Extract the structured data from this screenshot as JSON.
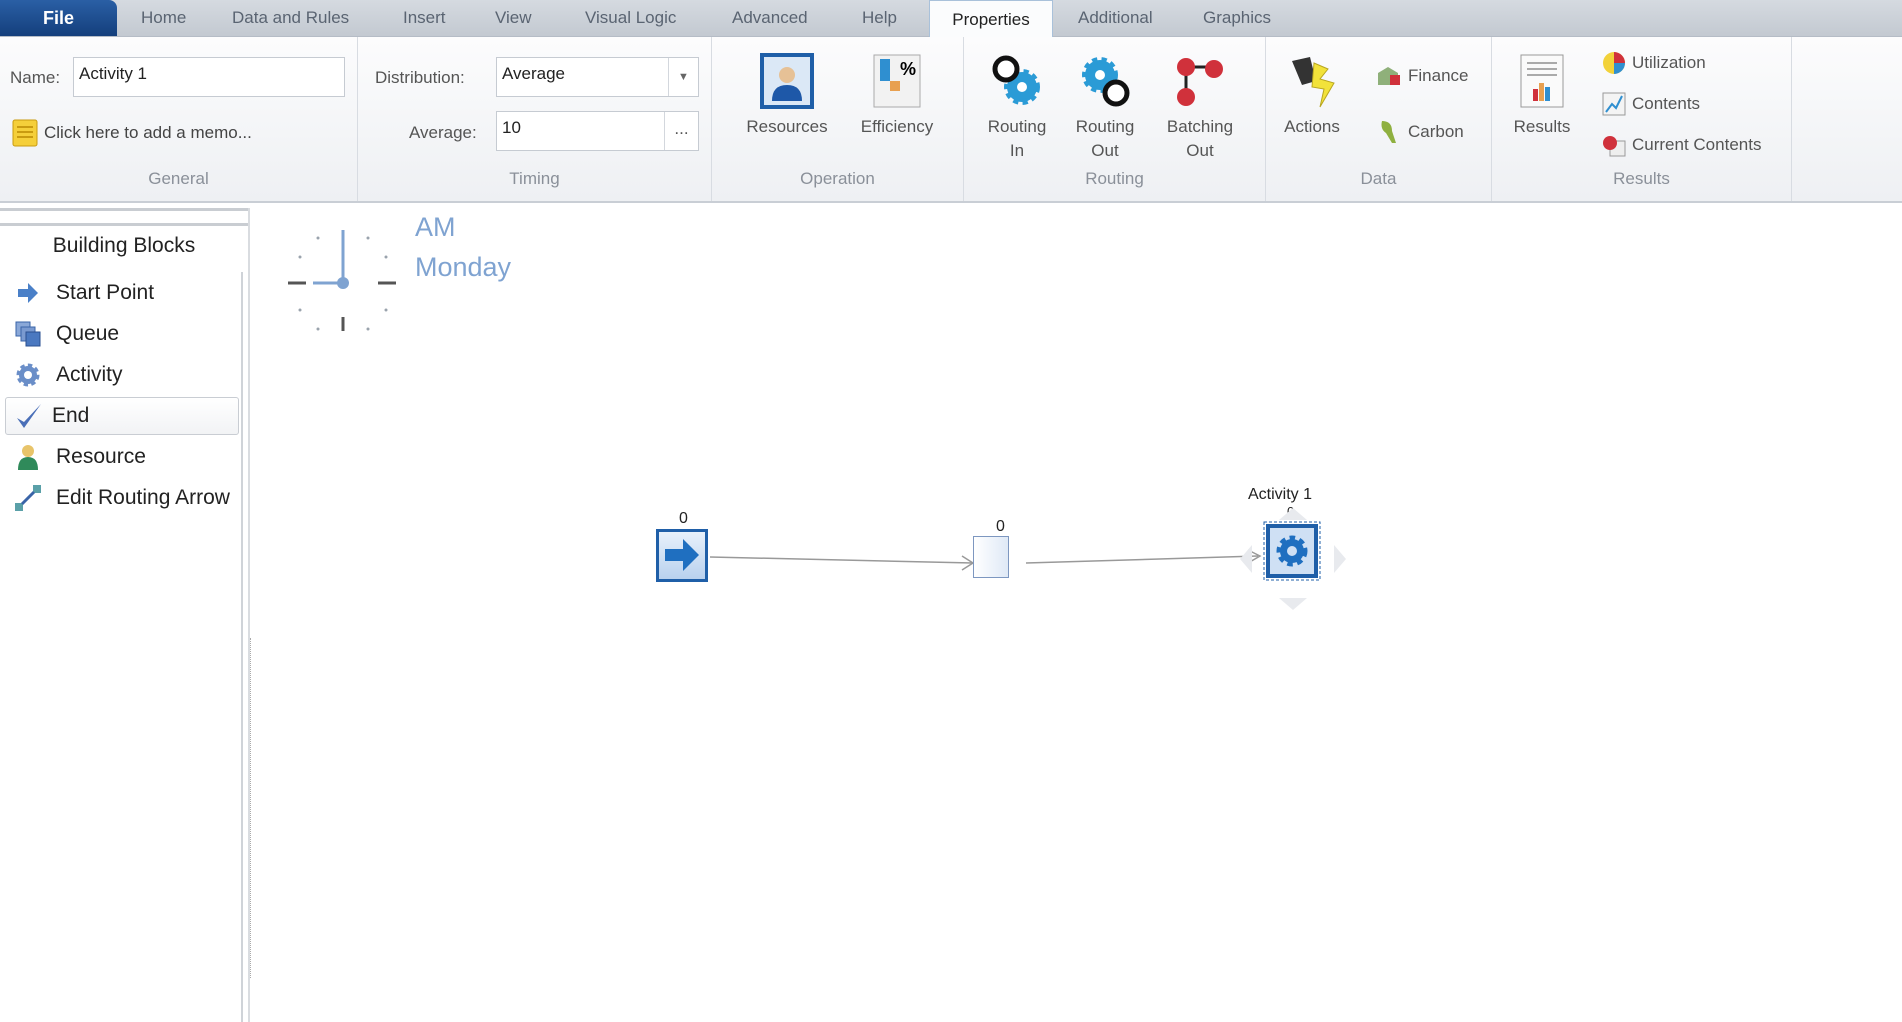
{
  "tabs": {
    "file": "File",
    "items": [
      "Home",
      "Data and Rules",
      "Insert",
      "View",
      "Visual Logic",
      "Advanced",
      "Help",
      "Properties",
      "Additional",
      "Graphics"
    ],
    "active": "Properties"
  },
  "general": {
    "name_label": "Name:",
    "name_value": "Activity 1",
    "memo": "Click here to add a memo...",
    "group": "General"
  },
  "timing": {
    "distribution_label": "Distribution:",
    "distribution_value": "Average",
    "average_label": "Average:",
    "average_value": "10",
    "more": "...",
    "group": "Timing"
  },
  "operation": {
    "resources": "Resources",
    "efficiency": "Efficiency",
    "group": "Operation"
  },
  "routing": {
    "in1": "Routing",
    "in2": "In",
    "out1": "Routing",
    "out2": "Out",
    "batch1": "Batching",
    "batch2": "Out",
    "group": "Routing"
  },
  "data": {
    "actions": "Actions",
    "finance": "Finance",
    "carbon": "Carbon",
    "group": "Data"
  },
  "results": {
    "results": "Results",
    "utilization": "Utilization",
    "contents": "Contents",
    "current_contents": "Current Contents",
    "group": "Results"
  },
  "panel": {
    "title": "Building Blocks",
    "items": [
      {
        "label": "Start Point",
        "icon": "arrow-right-icon"
      },
      {
        "label": "Queue",
        "icon": "queue-icon"
      },
      {
        "label": "Activity",
        "icon": "gear-icon"
      },
      {
        "label": "End",
        "icon": "checkmark-icon"
      },
      {
        "label": "Resource",
        "icon": "person-icon"
      },
      {
        "label": "Edit Routing Arrow",
        "icon": "routing-arrow-icon"
      }
    ],
    "selected": "End"
  },
  "clock": {
    "period": "AM",
    "day": "Monday"
  },
  "model": {
    "start_count": "0",
    "queue_count": "0",
    "activity_label": "Activity 1",
    "activity_count": "0"
  },
  "colors": {
    "accent": "#1f5fa8",
    "clock": "#7fa3d1"
  }
}
